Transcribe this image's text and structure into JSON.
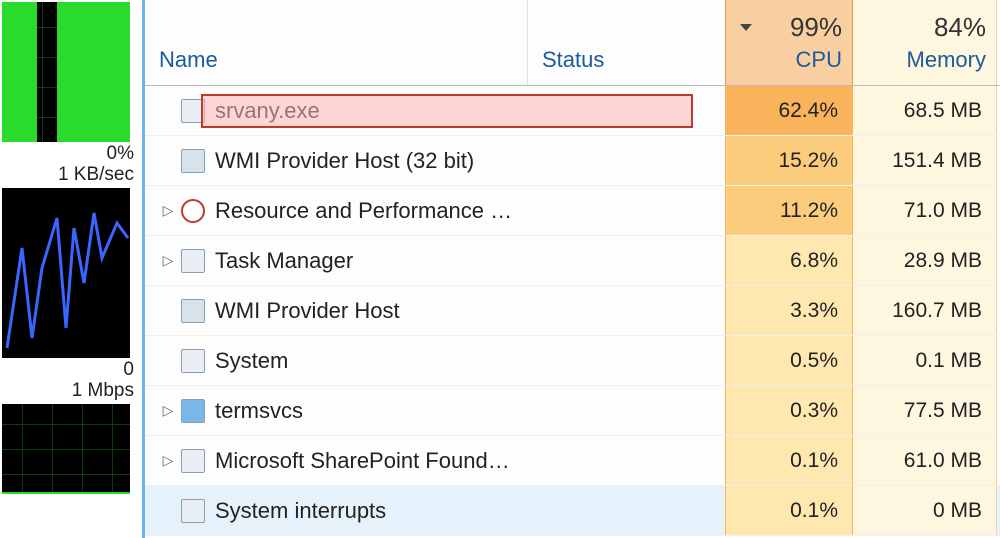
{
  "sidebar": {
    "labels": [
      "0%",
      "1 KB/sec",
      "0",
      "1 Mbps"
    ]
  },
  "columns": {
    "name": "Name",
    "status": "Status",
    "cpu_header_pct": "99%",
    "cpu_header_label": "CPU",
    "mem_header_pct": "84%",
    "mem_header_label": "Memory"
  },
  "heat_colors": {
    "cpu_high": "#f9b35a",
    "cpu_med": "#fccc7d",
    "cpu_low": "#ffe7b0",
    "mem_bg": "#fff6df"
  },
  "processes": [
    {
      "name": "srvany.exe",
      "cpu": "62.4%",
      "mem": "68.5 MB",
      "expandable": false,
      "icon": "app",
      "cpu_level": "high",
      "highlight": true
    },
    {
      "name": "WMI Provider Host (32 bit)",
      "cpu": "15.2%",
      "mem": "151.4 MB",
      "expandable": false,
      "icon": "wmi",
      "cpu_level": "med"
    },
    {
      "name": "Resource and Performance Mo...",
      "cpu": "11.2%",
      "mem": "71.0 MB",
      "expandable": true,
      "icon": "clock",
      "cpu_level": "med"
    },
    {
      "name": "Task Manager",
      "cpu": "6.8%",
      "mem": "28.9 MB",
      "expandable": true,
      "icon": "app",
      "cpu_level": "low"
    },
    {
      "name": "WMI Provider Host",
      "cpu": "3.3%",
      "mem": "160.7 MB",
      "expandable": false,
      "icon": "wmi",
      "cpu_level": "low"
    },
    {
      "name": "System",
      "cpu": "0.5%",
      "mem": "0.1 MB",
      "expandable": false,
      "icon": "app",
      "cpu_level": "low"
    },
    {
      "name": "termsvcs",
      "cpu": "0.3%",
      "mem": "77.5 MB",
      "expandable": true,
      "icon": "gear",
      "cpu_level": "low"
    },
    {
      "name": "Microsoft SharePoint Foundation",
      "cpu": "0.1%",
      "mem": "61.0 MB",
      "expandable": true,
      "icon": "app",
      "cpu_level": "low"
    },
    {
      "name": "System interrupts",
      "cpu": "0.1%",
      "mem": "0 MB",
      "expandable": false,
      "icon": "app",
      "cpu_level": "low",
      "selected": true
    }
  ]
}
